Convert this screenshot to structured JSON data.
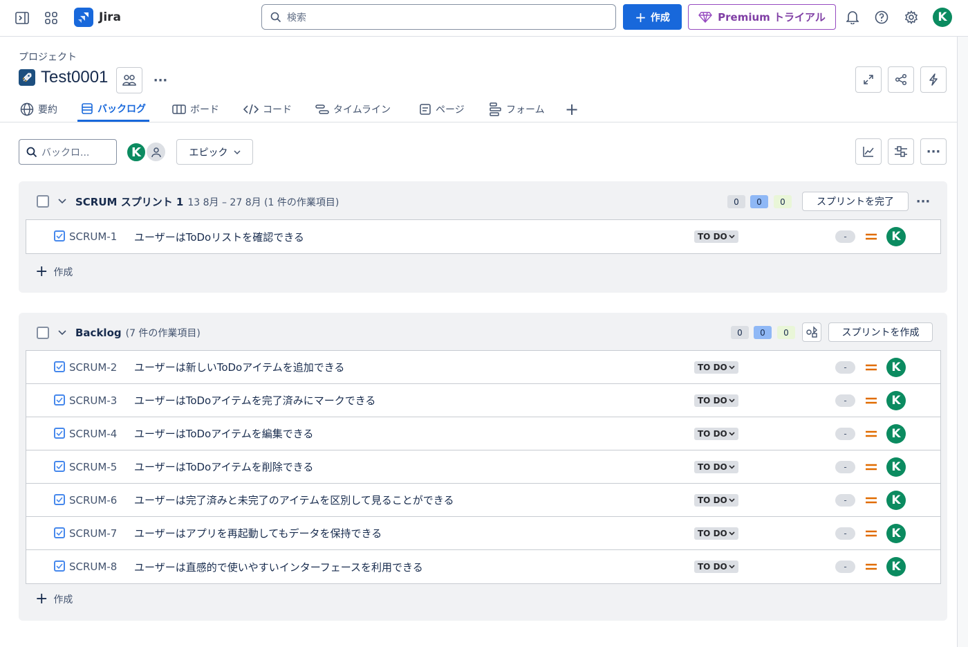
{
  "topbar": {
    "app_name": "Jira",
    "search_placeholder": "検索",
    "create_label": "作成",
    "premium_label": "Premium トライアル",
    "user_initial": "K"
  },
  "project": {
    "breadcrumb": "プロジェクト",
    "name": "Test0001"
  },
  "tabs": [
    {
      "label": "要約"
    },
    {
      "label": "バックログ"
    },
    {
      "label": "ボード"
    },
    {
      "label": "コード"
    },
    {
      "label": "タイムライン"
    },
    {
      "label": "ページ"
    },
    {
      "label": "フォーム"
    }
  ],
  "filters": {
    "search_placeholder": "バックロ...",
    "epic_label": "エピック",
    "assignee_initial": "K"
  },
  "sprint": {
    "name": "SCRUM スプリント 1",
    "dates": "13 8月 – 27 8月 (1 件の作業項目)",
    "counts": [
      "0",
      "0",
      "0"
    ],
    "complete_label": "スプリントを完了",
    "add_label": "作成",
    "items": [
      {
        "key": "SCRUM-1",
        "summary": "ユーザーはToDoリストを確認できる",
        "status": "TO DO",
        "estimate": "-",
        "assignee": "K"
      }
    ]
  },
  "backlog": {
    "name": "Backlog",
    "sub": "(7 件の作業項目)",
    "counts": [
      "0",
      "0",
      "0"
    ],
    "create_sprint_label": "スプリントを作成",
    "add_label": "作成",
    "items": [
      {
        "key": "SCRUM-2",
        "summary": "ユーザーは新しいToDoアイテムを追加できる",
        "status": "TO DO",
        "estimate": "-",
        "assignee": "K"
      },
      {
        "key": "SCRUM-3",
        "summary": "ユーザーはToDoアイテムを完了済みにマークできる",
        "status": "TO DO",
        "estimate": "-",
        "assignee": "K"
      },
      {
        "key": "SCRUM-4",
        "summary": "ユーザーはToDoアイテムを編集できる",
        "status": "TO DO",
        "estimate": "-",
        "assignee": "K"
      },
      {
        "key": "SCRUM-5",
        "summary": "ユーザーはToDoアイテムを削除できる",
        "status": "TO DO",
        "estimate": "-",
        "assignee": "K"
      },
      {
        "key": "SCRUM-6",
        "summary": "ユーザーは完了済みと未完了のアイテムを区別して見ることができる",
        "status": "TO DO",
        "estimate": "-",
        "assignee": "K"
      },
      {
        "key": "SCRUM-7",
        "summary": "ユーザーはアプリを再起動してもデータを保持できる",
        "status": "TO DO",
        "estimate": "-",
        "assignee": "K"
      },
      {
        "key": "SCRUM-8",
        "summary": "ユーザーは直感的で使いやすいインターフェースを利用できる",
        "status": "TO DO",
        "estimate": "-",
        "assignee": "K"
      }
    ]
  }
}
